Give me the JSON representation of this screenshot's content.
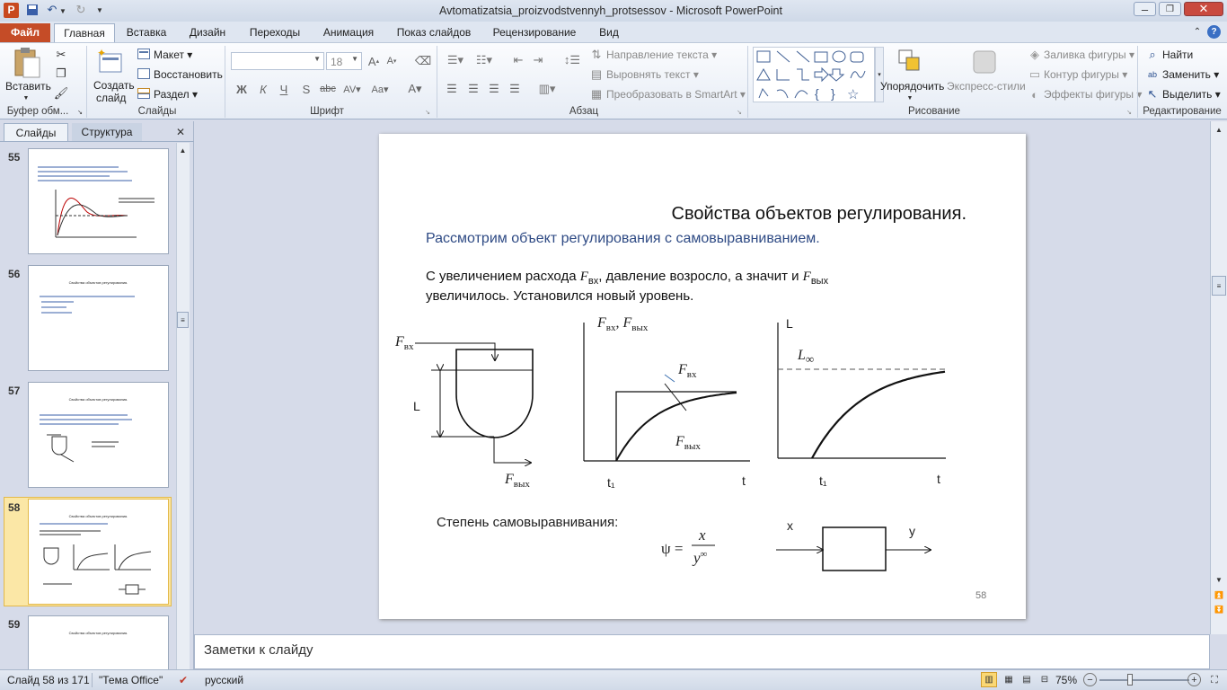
{
  "window": {
    "title": "Avtomatizatsia_proizvodstvennyh_protsessov  -  Microsoft PowerPoint"
  },
  "tabs": [
    "Файл",
    "Главная",
    "Вставка",
    "Дизайн",
    "Переходы",
    "Анимация",
    "Показ слайдов",
    "Рецензирование",
    "Вид"
  ],
  "ribbon": {
    "paste": "Вставить",
    "create_slide_1": "Создать",
    "create_slide_2": "слайд",
    "layout": "Макет",
    "reset": "Восстановить",
    "section": "Раздел",
    "font_size": "18",
    "text_direction": "Направление текста",
    "align_text": "Выровнять текст",
    "convert_smartart": "Преобразовать в SmartArt",
    "arrange": "Упорядочить",
    "quick_styles": "Экспресс-стили",
    "shape_fill": "Заливка фигуры",
    "shape_outline": "Контур фигуры",
    "shape_effects": "Эффекты фигуры",
    "find": "Найти",
    "replace": "Заменить",
    "select": "Выделить",
    "groups": {
      "clipboard": "Буфер обм...",
      "slides": "Слайды",
      "font": "Шрифт",
      "paragraph": "Абзац",
      "drawing": "Рисование",
      "editing": "Редактирование"
    }
  },
  "left_pane": {
    "tab_slides": "Слайды",
    "tab_outline": "Структура",
    "thumbnails": [
      {
        "number": "55",
        "title": ""
      },
      {
        "number": "56",
        "title": "Свойства объектов регулирования."
      },
      {
        "number": "57",
        "title": "Свойства объектов регулирования."
      },
      {
        "number": "58",
        "title": "Свойства объектов регулирования."
      },
      {
        "number": "59",
        "title": "Свойства объектов регулирования."
      }
    ]
  },
  "slide": {
    "title": "Свойства объектов регулирования.",
    "subtitle": "Рассмотрим объект регулирования с самовыравниванием.",
    "body_line1_a": "С увеличением расхода ",
    "body_line1_b": ", давление возросло, а значит и ",
    "body_line2": "увеличилось. Установился новый уровень.",
    "F": "F",
    "sub_in": "вх",
    "sub_out": "вых",
    "label_L": "L",
    "label_t1": "t₁",
    "label_t": "t",
    "label_Linf": "L",
    "label_inf": "∞",
    "axis_pair_sep": ", ",
    "self_leveling_label": "Степень самовыравнивания:",
    "psi": "ψ =",
    "num_x": "x",
    "den_y": "y",
    "label_x": "x",
    "label_y": "y",
    "page_number": "58"
  },
  "notes": {
    "placeholder": "Заметки к слайду"
  },
  "status": {
    "slide": "Слайд 58 из 171",
    "theme": "\"Тема Office\"",
    "language": "русский",
    "zoom": "75%"
  }
}
